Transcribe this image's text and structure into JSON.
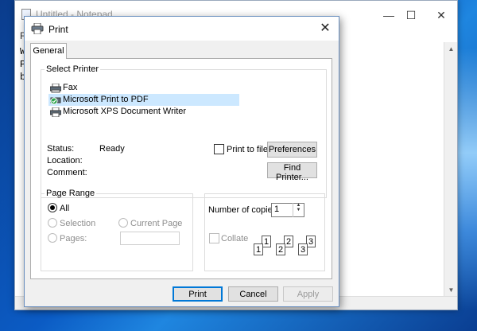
{
  "notepad": {
    "title": "Untitled - Notepad",
    "menu_text": "F",
    "text_lines": [
      "W",
      "P",
      "b"
    ],
    "controls": {
      "minimize": "—",
      "maximize": "☐",
      "close": "✕"
    }
  },
  "dialog": {
    "title": "Print",
    "close_glyph": "✕",
    "tab_label": "General",
    "select_printer": {
      "legend": "Select Printer",
      "printers": [
        {
          "name": "Fax",
          "icon": "fax-printer-icon"
        },
        {
          "name": "Microsoft Print to PDF",
          "icon": "default-printer-icon",
          "selected": true
        },
        {
          "name": "Microsoft XPS Document Writer",
          "icon": "printer-icon"
        }
      ],
      "status_label": "Status:",
      "status_value": "Ready",
      "location_label": "Location:",
      "comment_label": "Comment:",
      "print_to_file_label": "Print to file",
      "preferences_label": "Preferences",
      "find_printer_label": "Find Printer..."
    },
    "page_range": {
      "legend": "Page Range",
      "all_label": "All",
      "selection_label": "Selection",
      "current_page_label": "Current Page",
      "pages_label": "Pages:",
      "pages_value": ""
    },
    "copies": {
      "number_label": "Number of copies:",
      "number_value": "1",
      "collate_label": "Collate",
      "collate_pages": [
        "1",
        "1",
        "2",
        "2",
        "3",
        "3"
      ]
    },
    "buttons": {
      "print": "Print",
      "cancel": "Cancel",
      "apply": "Apply"
    }
  },
  "colors": {
    "accent": "#0078d7",
    "selection": "#cce8ff",
    "desktop": "#0b5bc4"
  }
}
